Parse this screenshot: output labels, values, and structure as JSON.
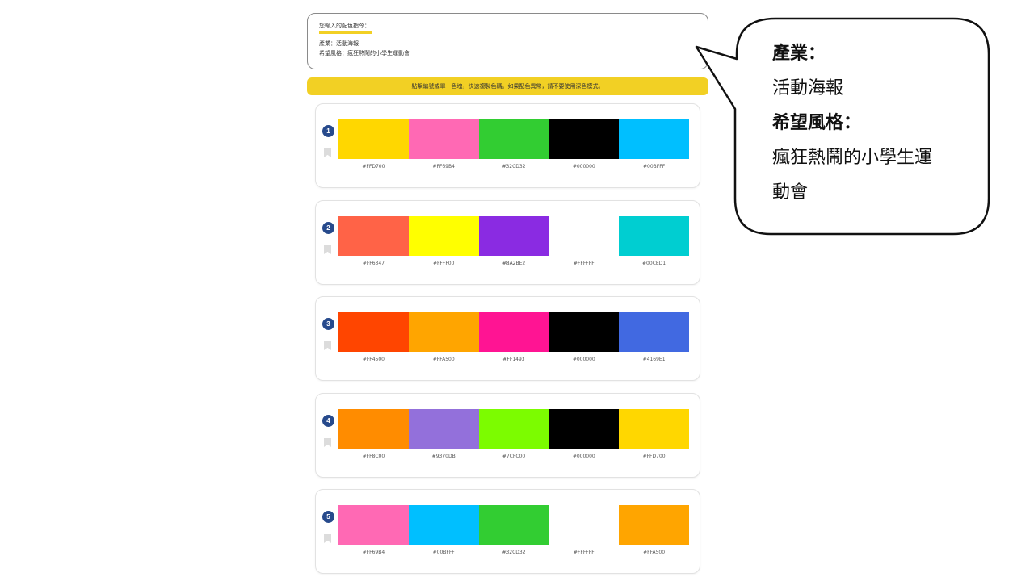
{
  "input_card": {
    "title": "您輸入的配色指令：",
    "industry_line": "產業：活動海報",
    "style_line": "希望風格：瘋狂熱鬧的小學生運動會"
  },
  "notice": "點擊編號或單一色塊，快速複製色碼。如果配色異常，請不要使用深色模式。",
  "palettes": [
    {
      "number": "1",
      "colors": [
        "#FFD700",
        "#FF69B4",
        "#32CD32",
        "#000000",
        "#00BFFF"
      ]
    },
    {
      "number": "2",
      "colors": [
        "#FF6347",
        "#FFFF00",
        "#8A2BE2",
        "#FFFFFF",
        "#00CED1"
      ]
    },
    {
      "number": "3",
      "colors": [
        "#FF4500",
        "#FFA500",
        "#FF1493",
        "#000000",
        "#4169E1"
      ]
    },
    {
      "number": "4",
      "colors": [
        "#FF8C00",
        "#9370DB",
        "#7CFC00",
        "#000000",
        "#FFD700"
      ]
    },
    {
      "number": "5",
      "colors": [
        "#FF69B4",
        "#00BFFF",
        "#32CD32",
        "#FFFFFF",
        "#FFA500"
      ]
    }
  ],
  "callout": {
    "industry_label": "產業：",
    "industry_value": "活動海報",
    "style_label": "希望風格：",
    "style_value_line1": "瘋狂熱鬧的小學生運",
    "style_value_line2": "動會"
  }
}
